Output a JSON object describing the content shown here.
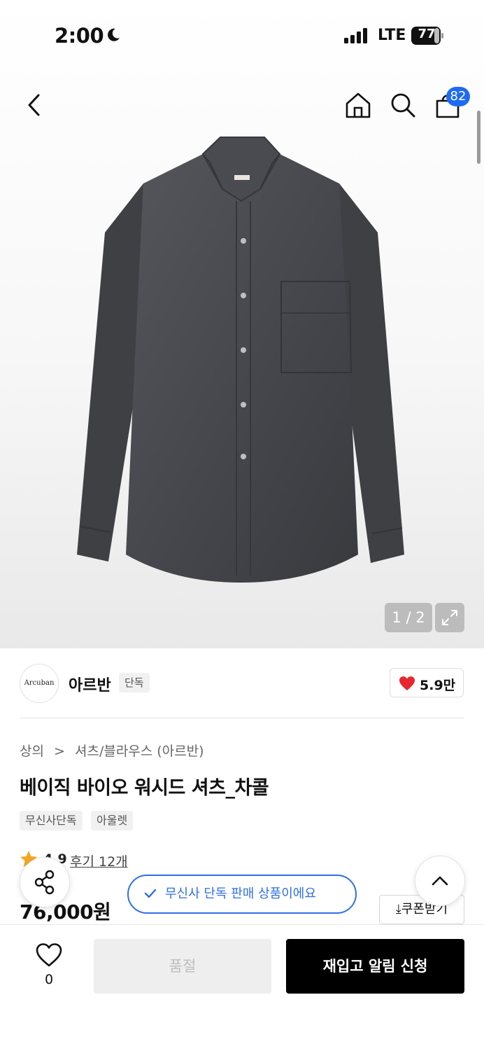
{
  "status_bar": {
    "time": "2:00",
    "network": "LTE",
    "battery": "77",
    "icons": [
      "moon-icon",
      "signal-icon",
      "battery-icon"
    ]
  },
  "nav": {
    "cart_badge": "82",
    "icons": [
      "back-icon",
      "home-icon",
      "search-icon",
      "cart-icon"
    ]
  },
  "gallery": {
    "counter": "1 / 2",
    "expand_icon": "expand-icon"
  },
  "brand": {
    "logo_text": "Arcuban",
    "name": "아르반",
    "tag": "단독",
    "likes": "5.9만"
  },
  "breadcrumb": {
    "level1": "상의",
    "separator": ">",
    "level2": "셔츠/블라우스 (아르반)"
  },
  "product": {
    "title": "베이직 바이오 워시드 셔츠_차콜",
    "tags": [
      "무신사단독",
      "아울렛"
    ],
    "rating": "4.9",
    "reviews": "후기 12개",
    "price": "76,000원",
    "coupon": "쿠폰받기"
  },
  "toast": {
    "text": "무신사 단독 판매 상품이에요"
  },
  "bottom_bar": {
    "wishlist_count": "0",
    "soldout_label": "품절",
    "restock_label": "재입고 알림 신청"
  },
  "colors": {
    "accent_blue": "#2f6fe6",
    "badge_blue": "#1e6bf2",
    "heart_red": "#e8262e",
    "star": "#f5a623"
  }
}
